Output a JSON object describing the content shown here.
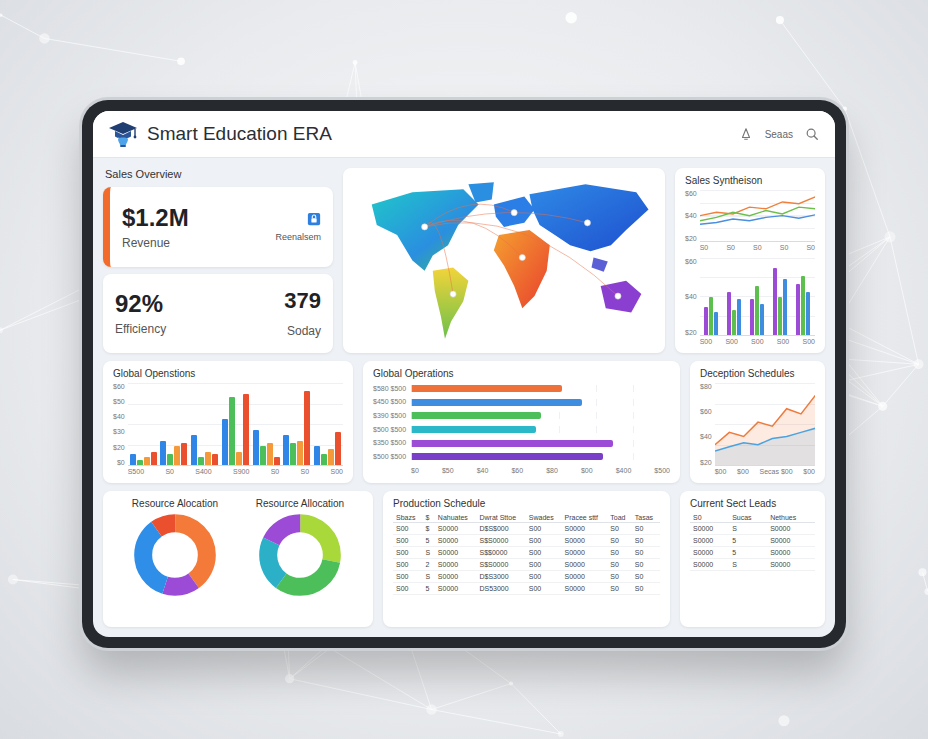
{
  "header": {
    "title": "Smart Education ERA",
    "user": "Seaas"
  },
  "sales_overview": {
    "title": "Sales Overview",
    "revenue": {
      "value": "$1.2M",
      "label": "Revenue",
      "link": "Reenalsem"
    },
    "efficiency": {
      "value": "92%",
      "label": "Efficiency"
    },
    "today": {
      "value": "379",
      "label": "Soday"
    }
  },
  "sales_synthesis": {
    "title": "Sales Syntheison",
    "line_y_ticks": [
      "$60",
      "$40",
      "$20"
    ],
    "line_x_ticks": [
      "S0",
      "S0",
      "S0",
      "S0",
      "S0"
    ],
    "lines": [
      {
        "color": "#f0803c",
        "values": [
          30,
          34,
          32,
          40,
          38,
          46,
          44,
          52
        ]
      },
      {
        "color": "#6cc04a",
        "values": [
          24,
          28,
          34,
          30,
          36,
          32,
          40,
          38
        ]
      },
      {
        "color": "#4a8fe0",
        "values": [
          20,
          22,
          26,
          24,
          28,
          30,
          27,
          31
        ]
      }
    ],
    "bar_y_ticks": [
      "$60",
      "$40",
      "$20"
    ],
    "bar_x_ticks": [
      "S00",
      "S00",
      "S00",
      "S00",
      "S00"
    ],
    "bars": [
      {
        "color": "#9b4bd6",
        "values": [
          22,
          34,
          28,
          52,
          40
        ]
      },
      {
        "color": "#5cbf4e",
        "values": [
          30,
          20,
          38,
          30,
          46
        ]
      },
      {
        "color": "#3f8de0",
        "values": [
          18,
          28,
          24,
          44,
          34
        ]
      }
    ]
  },
  "global_operations_bars": {
    "title": "Global Openstions",
    "y_ticks": [
      "$60",
      "$50",
      "$40",
      "$30",
      "$20",
      "$0"
    ],
    "x_ticks": [
      "S500",
      "S0",
      "S400",
      "S900",
      "S0",
      "S0",
      "S00"
    ],
    "series": [
      {
        "color": "#2f86e6",
        "values": [
          8,
          18,
          22,
          34,
          26,
          22,
          14
        ]
      },
      {
        "color": "#4cbf5a",
        "values": [
          4,
          8,
          6,
          50,
          14,
          16,
          8
        ]
      },
      {
        "color": "#f59a3a",
        "values": [
          6,
          14,
          10,
          10,
          16,
          18,
          12
        ]
      },
      {
        "color": "#ea4f2e",
        "values": [
          10,
          16,
          8,
          52,
          6,
          54,
          24
        ]
      }
    ]
  },
  "global_operations_rows": {
    "title": "Global Operations",
    "bars": [
      {
        "label": "$580 $500",
        "value": 290,
        "color": "#f0703a"
      },
      {
        "label": "$450 $500",
        "value": 330,
        "color": "#3f8de0"
      },
      {
        "label": "$390 $500",
        "value": 250,
        "color": "#4cbf5a"
      },
      {
        "label": "$500 $500",
        "value": 240,
        "color": "#2bb8c8"
      },
      {
        "label": "$350 $500",
        "value": 390,
        "color": "#9b4bd6"
      },
      {
        "label": "$500 $500",
        "value": 370,
        "color": "#7a3fc8"
      }
    ],
    "x_ticks": [
      "$0",
      "$50",
      "$40",
      "$60",
      "$80",
      "$00",
      "$400",
      "$500"
    ]
  },
  "deception_schedules": {
    "title": "Deception Schedules",
    "y_ticks": [
      "$80",
      "$60",
      "$40",
      "$20"
    ],
    "x_ticks": [
      "$00",
      "$00",
      "Secas $00",
      "$00"
    ],
    "lines": [
      {
        "color": "#f07a3a",
        "values": [
          20,
          32,
          28,
          42,
          38,
          55,
          50,
          68
        ]
      },
      {
        "color": "#4aa3e0",
        "values": [
          14,
          18,
          22,
          20,
          26,
          28,
          32,
          36
        ]
      }
    ]
  },
  "resource_allocation": [
    {
      "title": "Resource Alocation",
      "segments": [
        {
          "value": 40,
          "color": "#f47a3a"
        },
        {
          "value": 15,
          "color": "#9b4bd6"
        },
        {
          "value": 35,
          "color": "#2f8fe8"
        },
        {
          "value": 10,
          "color": "#ea4f2e"
        }
      ]
    },
    {
      "title": "Resource Allocation",
      "segments": [
        {
          "value": 28,
          "color": "#a8d83a"
        },
        {
          "value": 32,
          "color": "#4cbf5a"
        },
        {
          "value": 22,
          "color": "#2bb0c8"
        },
        {
          "value": 18,
          "color": "#9b4bd6"
        }
      ]
    }
  ],
  "production_schedule": {
    "title": "Production Schedule",
    "columns": [
      "Sbazs",
      "$",
      "Nahuates",
      "Dwrat Sttoe",
      "Swades",
      "Pracee sttf",
      "Toad",
      "Tasas"
    ],
    "rows": [
      [
        "S00",
        "$",
        "S0000",
        "D$S$000",
        "S00",
        "S0000",
        "S0",
        "S0"
      ],
      [
        "S00",
        "5",
        "S0000",
        "S$S0000",
        "S00",
        "S0000",
        "S0",
        "S0"
      ],
      [
        "S00",
        "S",
        "S0000",
        "S$$0000",
        "S00",
        "S0000",
        "S0",
        "S0"
      ],
      [
        "S00",
        "2",
        "S0000",
        "S$S0000",
        "S00",
        "S0000",
        "S0",
        "S0"
      ],
      [
        "S00",
        "S",
        "S0000",
        "D$S3000",
        "S00",
        "S0000",
        "S0",
        "S0"
      ],
      [
        "S00",
        "5",
        "S0000",
        "DS53000",
        "S00",
        "S0000",
        "S0",
        "S0"
      ]
    ]
  },
  "current_leads": {
    "title": "Current Sect Leads",
    "columns": [
      "S0",
      "Sucas",
      "Nethues"
    ],
    "rows": [
      [
        "S0000",
        "S",
        "S0000"
      ],
      [
        "S0000",
        "5",
        "S0000"
      ],
      [
        "S0000",
        "5",
        "S0000"
      ],
      [
        "S0000",
        "S",
        "S0000"
      ]
    ]
  }
}
